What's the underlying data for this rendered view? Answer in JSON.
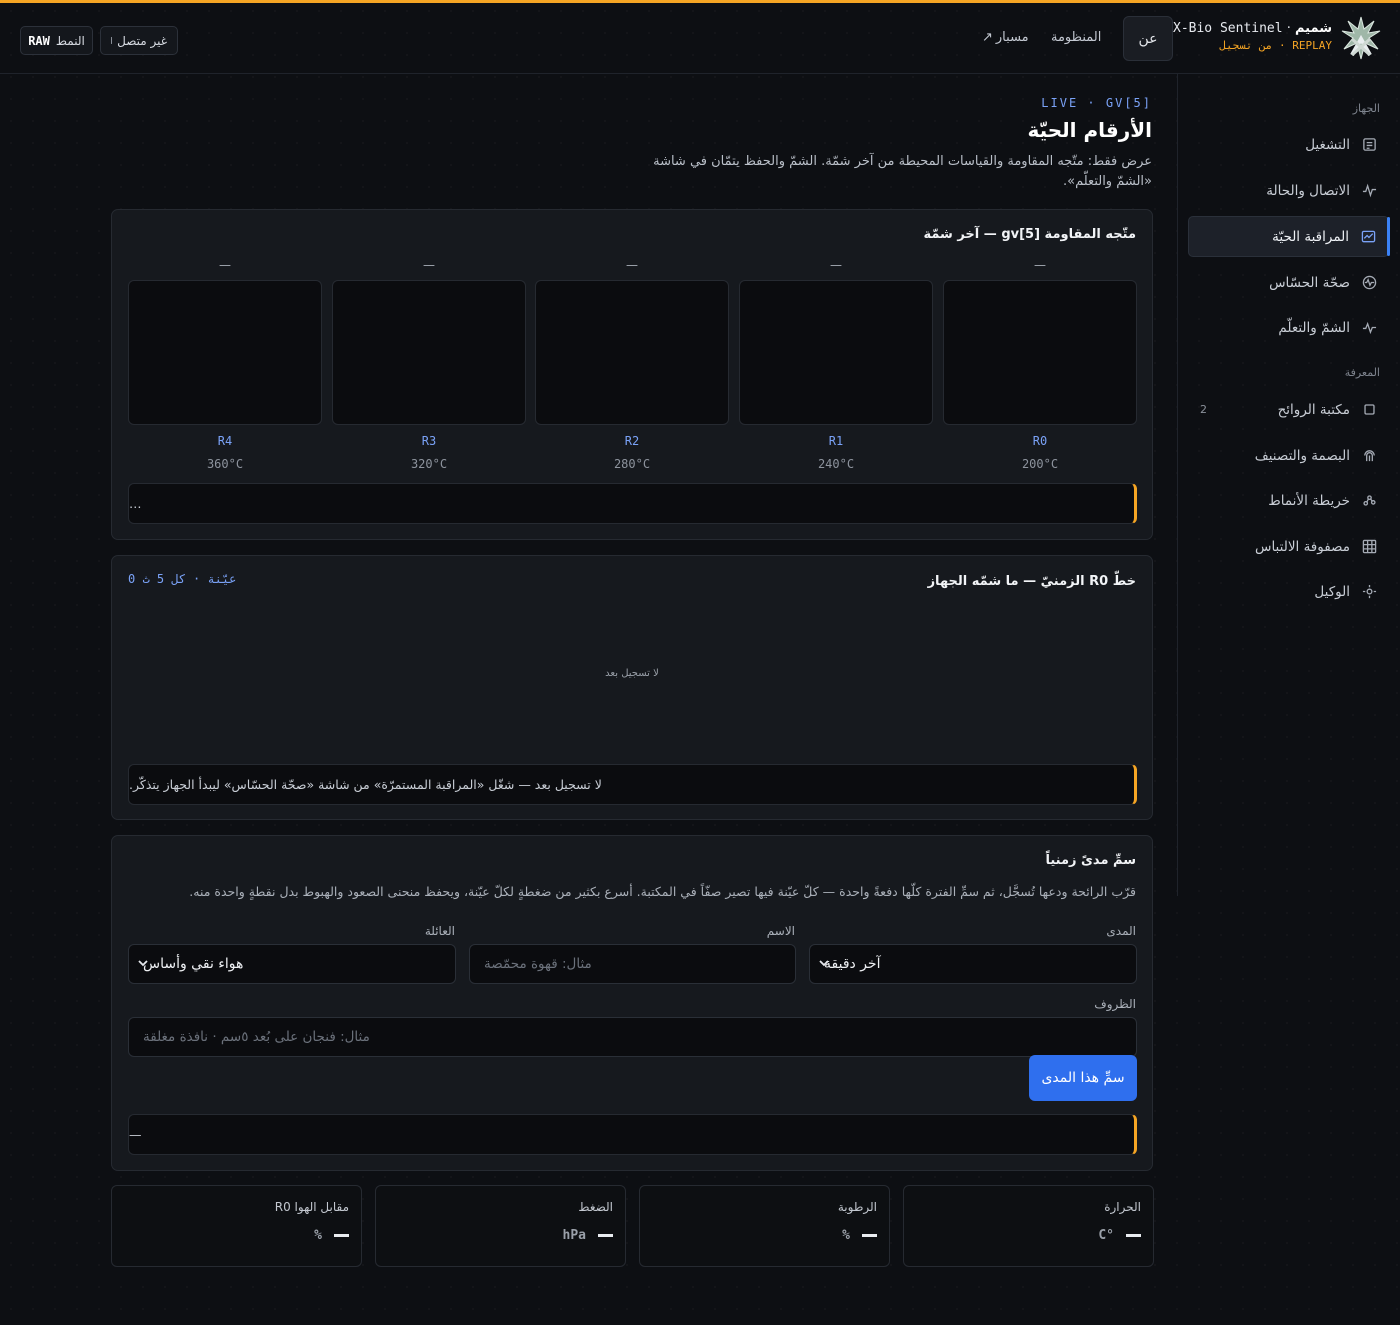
{
  "header": {
    "brand_name": "شميم",
    "brand_product": "X-Bio Sentinel",
    "brand_mode": "REPLAY",
    "brand_mode_note": "من تسجيل",
    "about_label": "عن",
    "nav_system": "المنظومة",
    "nav_path": "مسبار",
    "status_label": "غير متصل",
    "mode_prefix": "النمط",
    "mode_value": "RAW"
  },
  "sidebar": {
    "section_device": "الجهاز",
    "section_knowledge": "المعرفة",
    "items": [
      {
        "label": "التشغيل",
        "icon": "document-icon"
      },
      {
        "label": "الاتصال والحالة",
        "icon": "pulse-icon"
      },
      {
        "label": "المراقبة الحيّة",
        "icon": "chart-monitor-icon"
      },
      {
        "label": "صحّة الحسّاس",
        "icon": "heart-rate-icon"
      },
      {
        "label": "الشمّ والتعلّم",
        "icon": "sparkle-icon"
      },
      {
        "label": "مكتبة الروائح",
        "icon": "square-icon",
        "badge": "2"
      },
      {
        "label": "البصمة والتصنيف",
        "icon": "fingerprint-icon"
      },
      {
        "label": "خريطة الأنماط",
        "icon": "scatter-icon"
      },
      {
        "label": "مصفوفة الالتباس",
        "icon": "grid-icon"
      },
      {
        "label": "الوكيل",
        "icon": "agent-icon"
      }
    ]
  },
  "page": {
    "eyebrow": "LIVE · GV[5]",
    "title": "الأرقام الحيّة",
    "description": "عرض فقط: متّجه المقاومة والقياسات المحيطة من آخر شمّة. الشمّ والحفظ يتمّان في شاشة «الشمّ والتعلّم»."
  },
  "resistance_card": {
    "title": "متّجه المقاومة gv[5] — آخر شمّة",
    "sensors": [
      {
        "label": "R0",
        "temp": "200°C",
        "value": "—"
      },
      {
        "label": "R1",
        "temp": "240°C",
        "value": "—"
      },
      {
        "label": "R2",
        "temp": "280°C",
        "value": "—"
      },
      {
        "label": "R3",
        "temp": "320°C",
        "value": "—"
      },
      {
        "label": "R4",
        "temp": "360°C",
        "value": "—"
      }
    ],
    "message": "…"
  },
  "timeline_card": {
    "title": "خطّ R0 الزمنيّ — ما شمّه الجهاز",
    "meta": "0 عيّنة · كل 5 ث",
    "empty": "لا تسجيل بعد",
    "message": "لا تسجيل بعد — شغّل «المراقبة المستمرّة» من شاشة «صحّة الحسّاس» ليبدأ الجهاز يتذكّر."
  },
  "label_card": {
    "title": "سمِّ مدىً زمنياً",
    "description": "قرّب الرائحة ودعها تُسجَّل، ثم سمِّ الفترة كلّها دفعةً واحدة — كلّ عيّنة فيها تصير صفّاً في المكتبة. أسرع بكثير من ضغطةٍ لكلّ عيّنة، ويحفظ منحنى الصعود والهبوط بدل نقطةٍ واحدة منه.",
    "range_label": "المدى",
    "range_value": "آخر دقيقة",
    "name_label": "الاسم",
    "name_placeholder": "مثال: قهوة محمّصة",
    "family_label": "العائلة",
    "family_value": "هواء نقي وأساس",
    "conditions_label": "الظروف",
    "conditions_placeholder": "مثال: فنجان على بُعد ٥سم · نافذة مغلقة",
    "submit_label": "سمِّ هذا المدى",
    "message": "—"
  },
  "stats": [
    {
      "label": "الحرارة",
      "unit": "C°",
      "value": ""
    },
    {
      "label": "الرطوبة",
      "unit": "%",
      "value": ""
    },
    {
      "label": "الضغط",
      "unit": "hPa",
      "value": ""
    },
    {
      "label": "R0 مقابل الهوا",
      "unit": "%",
      "value": ""
    }
  ],
  "colors": {
    "accent": "#f5a524",
    "primary": "#2f6fee",
    "link": "#7aa2f7"
  }
}
